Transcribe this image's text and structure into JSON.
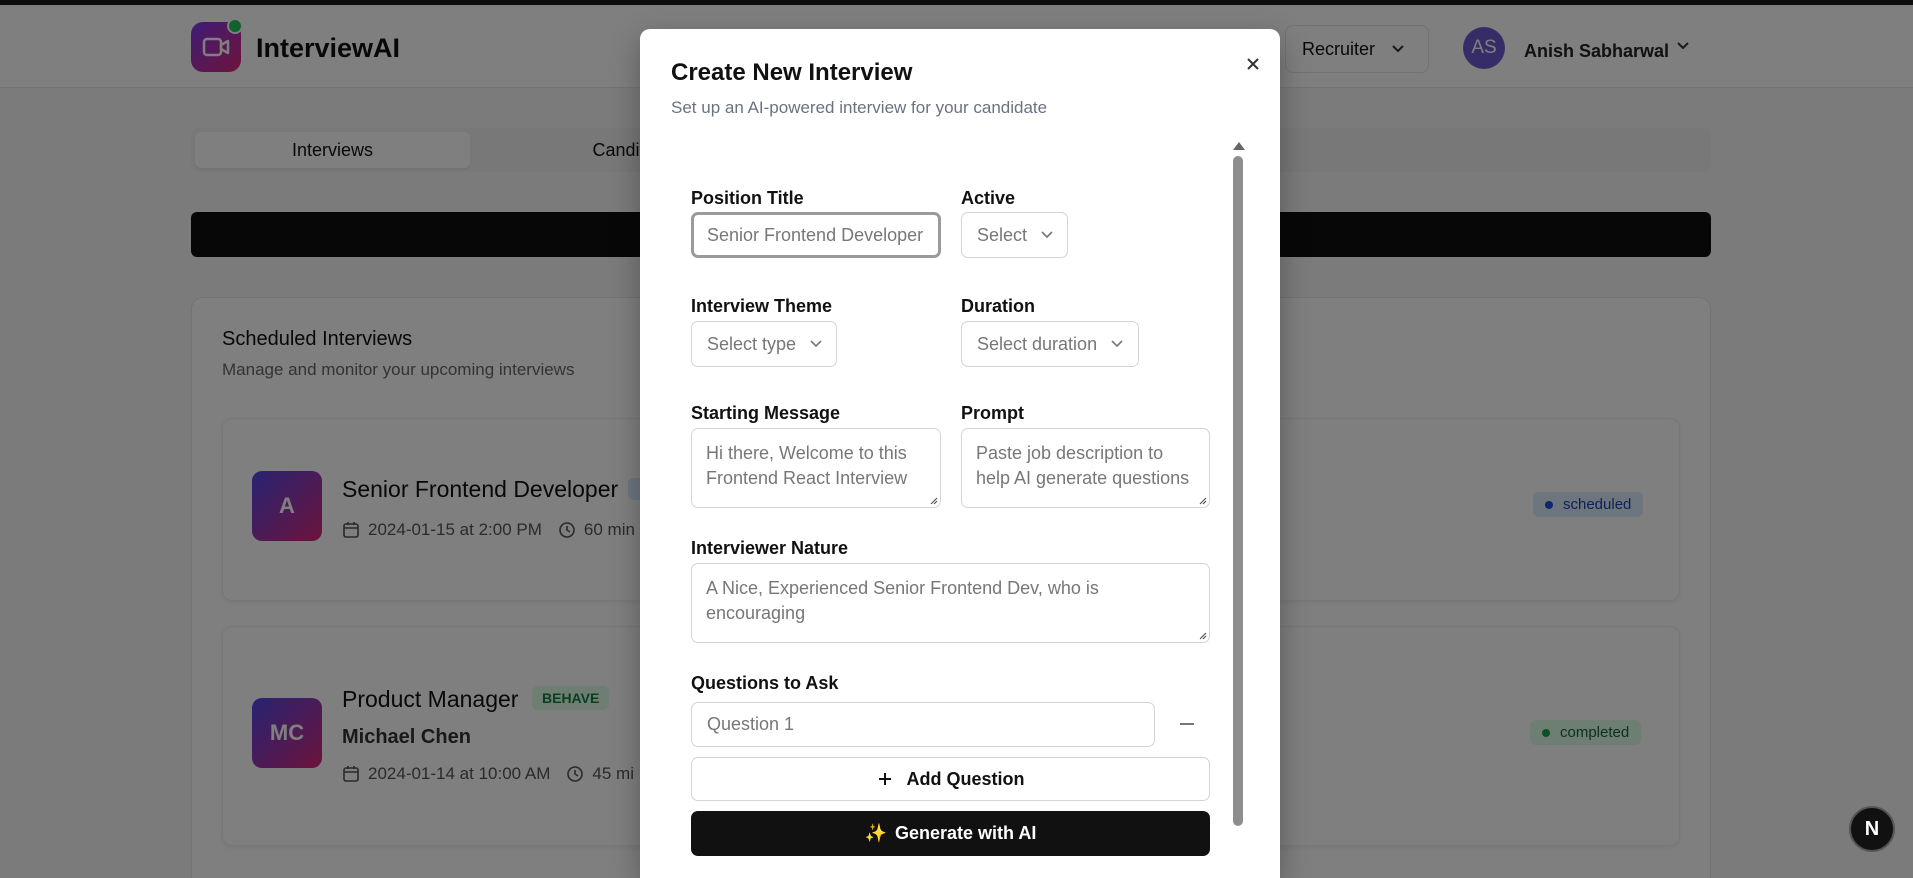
{
  "app": {
    "brand": "InterviewAI",
    "role_selector": "Recruiter",
    "user_initials": "AS",
    "user_name": "Anish Sabharwal"
  },
  "tabs": [
    {
      "label": "Interviews"
    },
    {
      "label": "Candidates An"
    }
  ],
  "section": {
    "title": "Scheduled Interviews",
    "subtitle": "Manage and monitor your upcoming interviews"
  },
  "interviews": [
    {
      "avatar": "A",
      "title": "Senior Frontend Developer",
      "date": "2024-01-15 at 2:00 PM",
      "duration": "60 min",
      "status": "scheduled"
    },
    {
      "avatar": "MC",
      "title": "Product Manager",
      "tag": "BEHAVE",
      "candidate": "Michael Chen",
      "date": "2024-01-14 at 10:00 AM",
      "duration": "45 mi",
      "status": "completed"
    }
  ],
  "modal": {
    "title": "Create New Interview",
    "subtitle": "Set up an AI-powered interview for your candidate",
    "position_label": "Position Title",
    "position_placeholder": "Senior Frontend Developer",
    "active_label": "Active",
    "active_placeholder": "Select",
    "theme_label": "Interview Theme",
    "theme_placeholder": "Select type",
    "duration_label": "Duration",
    "duration_placeholder": "Select duration",
    "starting_label": "Starting Message",
    "starting_line1": "Hi there, Welcome to this",
    "starting_line2": "Frontend React Interview",
    "prompt_label": "Prompt",
    "prompt_line1": "Paste job description to",
    "prompt_line2": "help AI generate questions",
    "nature_label": "Interviewer Nature",
    "nature_placeholder": "A Nice, Experienced Senior Frontend Dev, who is encouraging",
    "questions_label": "Questions to Ask",
    "question1_placeholder": "Question 1",
    "add_question": "Add Question",
    "generate": "Generate with AI",
    "generate_icon": "✨"
  },
  "dev_badge": "N",
  "colors": {
    "accent_dark": "#111111",
    "scheduled_bg": "#dbeafe",
    "completed_bg": "#dcfce7"
  }
}
